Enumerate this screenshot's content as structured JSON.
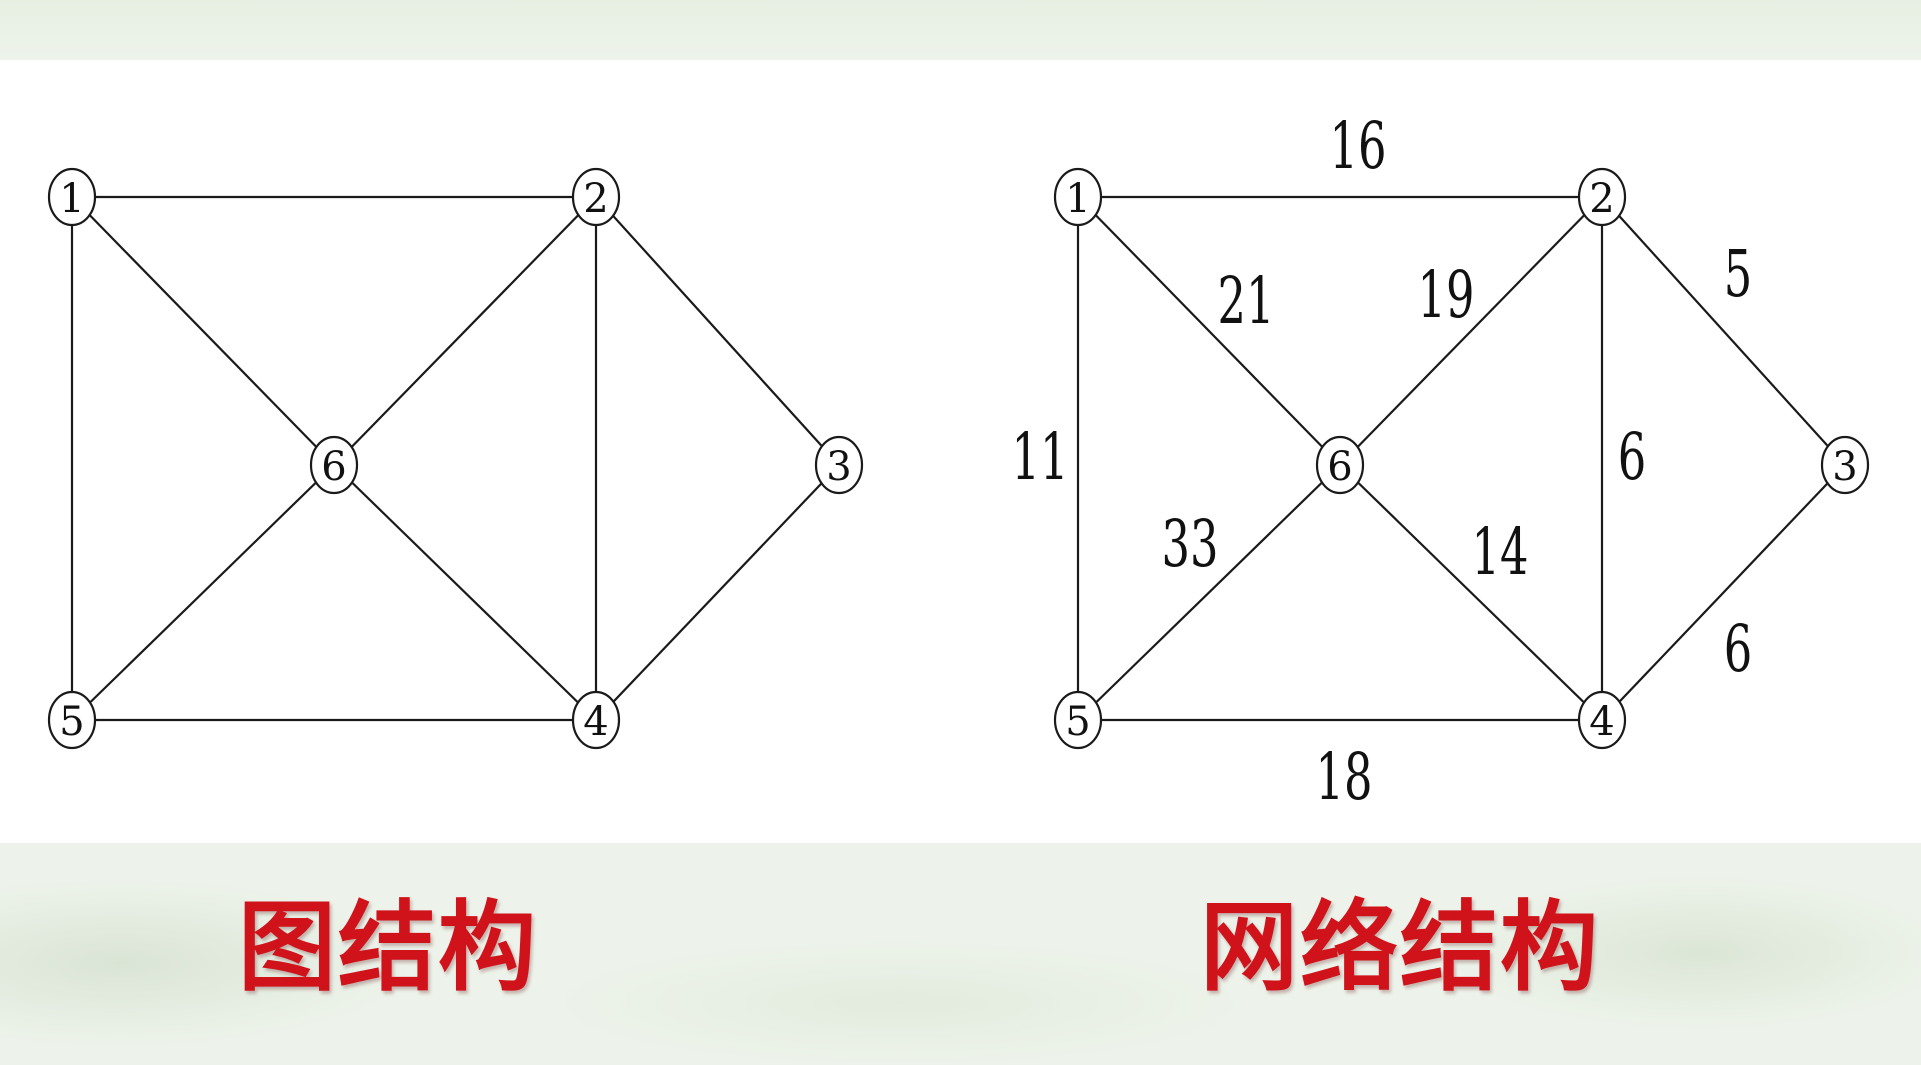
{
  "colors": {
    "caption": "#d0121b",
    "line": "#1a1a1a",
    "panel": "#ffffff",
    "background": "#eef3ea"
  },
  "graph": {
    "caption": "图结构",
    "nodes": [
      {
        "id": "1",
        "label": "1"
      },
      {
        "id": "2",
        "label": "2"
      },
      {
        "id": "3",
        "label": "3"
      },
      {
        "id": "4",
        "label": "4"
      },
      {
        "id": "5",
        "label": "5"
      },
      {
        "id": "6",
        "label": "6"
      }
    ],
    "edges": [
      {
        "from": "1",
        "to": "2"
      },
      {
        "from": "1",
        "to": "5"
      },
      {
        "from": "1",
        "to": "6"
      },
      {
        "from": "2",
        "to": "6"
      },
      {
        "from": "2",
        "to": "4"
      },
      {
        "from": "2",
        "to": "3"
      },
      {
        "from": "3",
        "to": "4"
      },
      {
        "from": "5",
        "to": "6"
      },
      {
        "from": "6",
        "to": "4"
      },
      {
        "from": "5",
        "to": "4"
      }
    ]
  },
  "network": {
    "caption": "网络结构",
    "nodes": [
      {
        "id": "1",
        "label": "1"
      },
      {
        "id": "2",
        "label": "2"
      },
      {
        "id": "3",
        "label": "3"
      },
      {
        "id": "4",
        "label": "4"
      },
      {
        "id": "5",
        "label": "5"
      },
      {
        "id": "6",
        "label": "6"
      }
    ],
    "edges": [
      {
        "from": "1",
        "to": "2",
        "weight": "16"
      },
      {
        "from": "1",
        "to": "6",
        "weight": "21"
      },
      {
        "from": "6",
        "to": "2",
        "weight": "19"
      },
      {
        "from": "2",
        "to": "3",
        "weight": "5"
      },
      {
        "from": "1",
        "to": "5",
        "weight": "11"
      },
      {
        "from": "2",
        "to": "4",
        "weight": "6"
      },
      {
        "from": "5",
        "to": "6",
        "weight": "33"
      },
      {
        "from": "6",
        "to": "4",
        "weight": "14"
      },
      {
        "from": "4",
        "to": "3",
        "weight": "6"
      },
      {
        "from": "5",
        "to": "4",
        "weight": "18"
      }
    ]
  }
}
